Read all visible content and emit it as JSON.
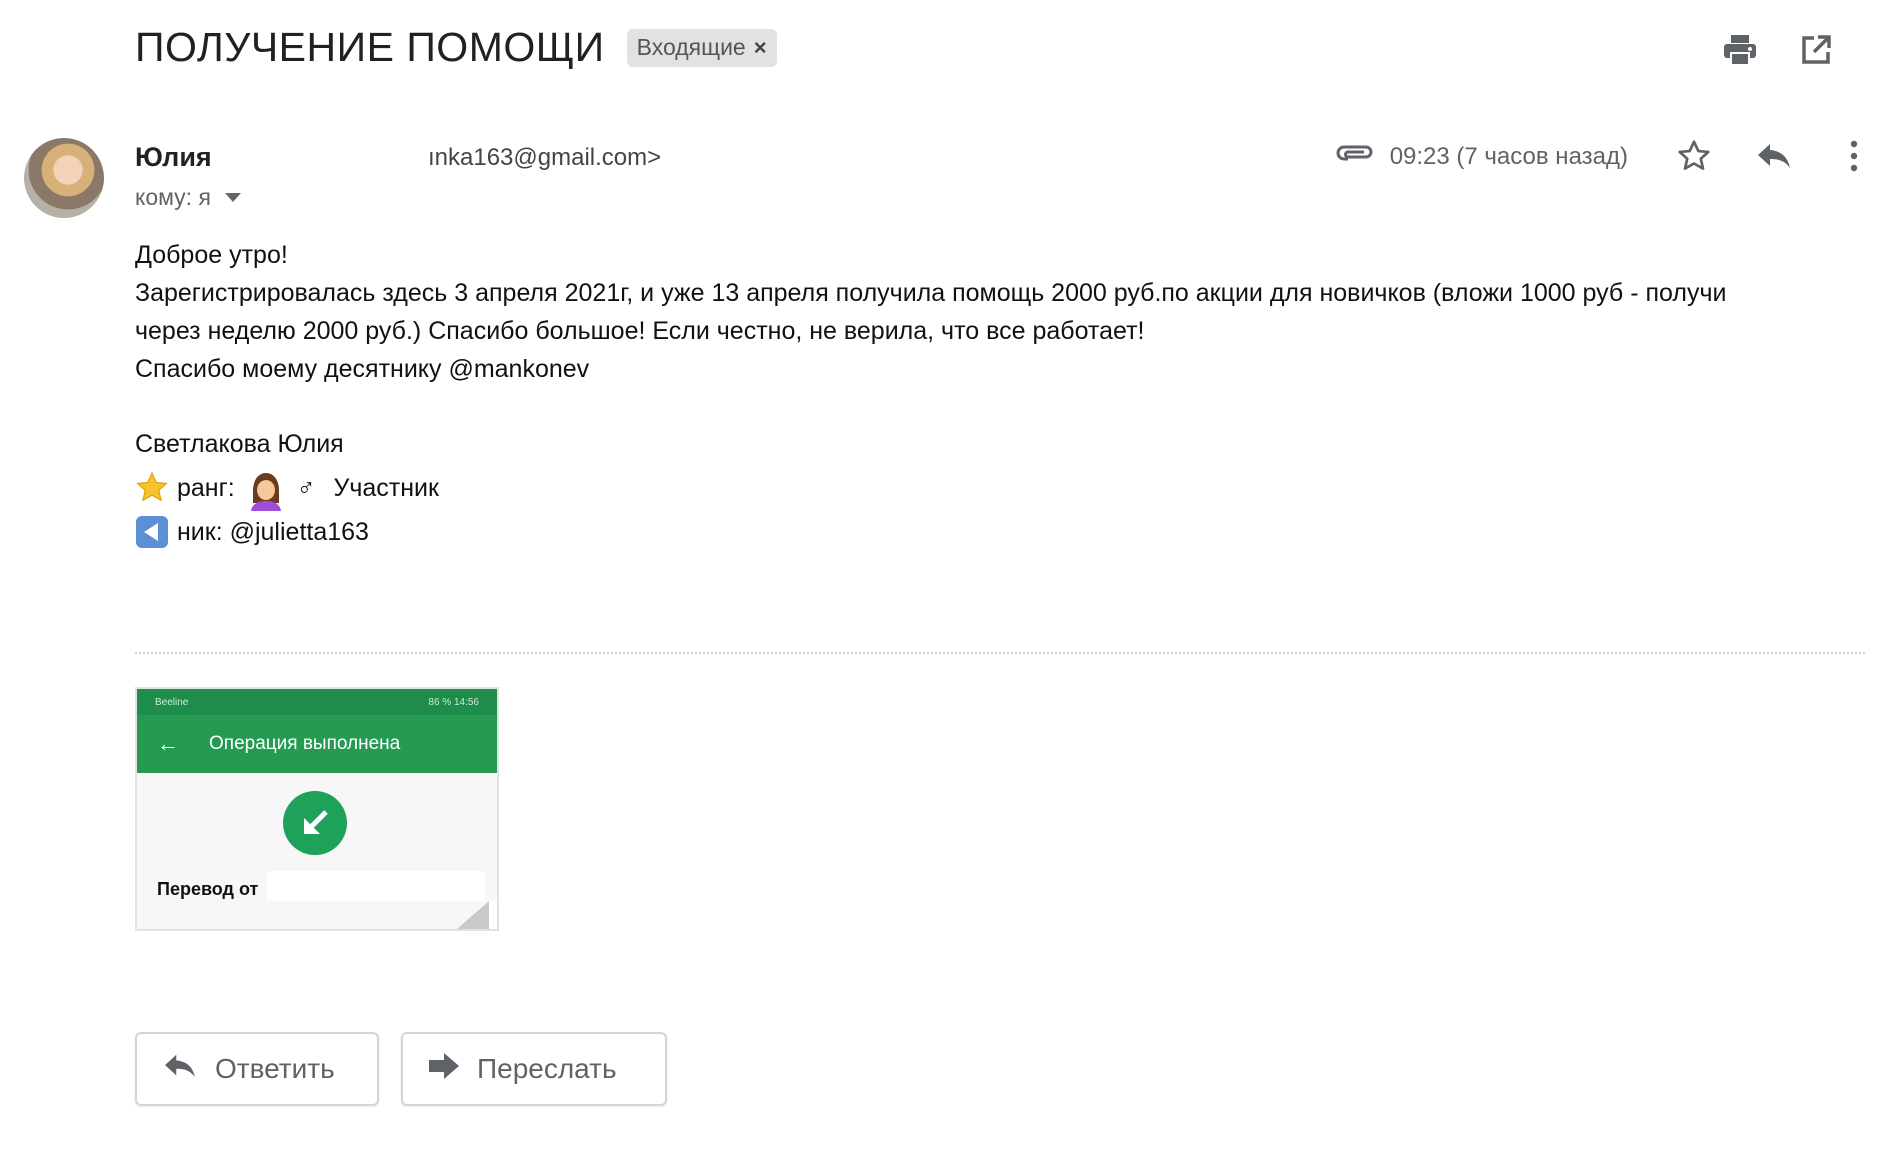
{
  "subject": {
    "title": "ПОЛУЧЕНИЕ ПОМОЩИ",
    "label": "Входящие",
    "label_remove": "×"
  },
  "top_icons": [
    "printer-icon",
    "open-in-new-window-icon"
  ],
  "message": {
    "sender_name": "Юлия",
    "sender_email": "ınka163@gmail.com>",
    "recipient": "кому: я",
    "time": "09:23 (7 часов назад)",
    "body_lines": [
      "Доброе утро!",
      "Зарегистрировалась здесь 3 апреля 2021г, и уже 13 апреля получила помощь 2000 руб.по акции для новичков (вложи 1000 руб - получи",
      "через неделю 2000 руб.) Спасибо большое! Если честно, не верила, что все работает!",
      "Спасибо моему десятнику  @mankonev"
    ],
    "signature": {
      "name": "Светлакова Юлия",
      "rank_label": "ранг:",
      "rank_symbol": "♂",
      "rank_value": "Участник",
      "nick_label": "ник: @julietta163"
    }
  },
  "attachment": {
    "status_left": "Beeline",
    "status_right": "86 %  14:56",
    "bar_title": "Операция выполнена",
    "transfer_label": "Перевод от"
  },
  "actions": {
    "reply": "Ответить",
    "forward": "Переслать"
  },
  "colors": {
    "accent_green": "#249a53",
    "icon_gray": "#5f6368",
    "chip_bg": "#e2e2e2",
    "star_yellow": "#f7c22e"
  }
}
